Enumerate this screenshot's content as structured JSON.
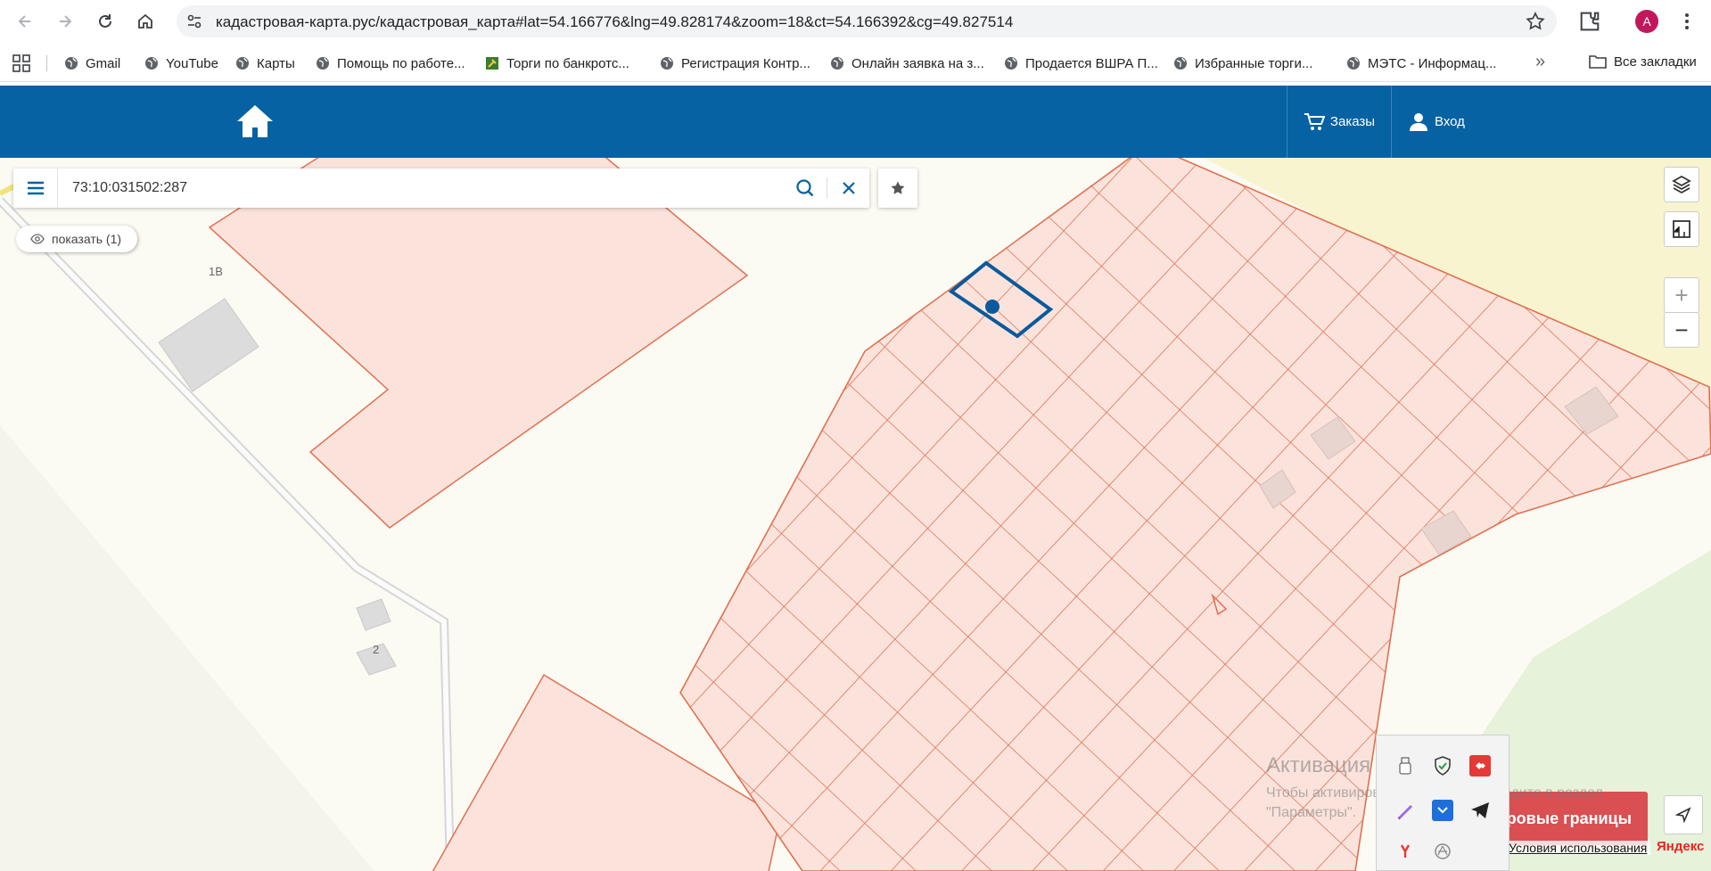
{
  "browser": {
    "url": "кадастровая-карта.рус/кадастровая_карта#lat=54.166776&lng=49.828174&zoom=18&ct=54.166392&cg=49.827514",
    "profile_initial": "A",
    "bookmarks": [
      {
        "label": "Gmail",
        "icon": "gmail-icon"
      },
      {
        "label": "YouTube",
        "icon": "globe-icon"
      },
      {
        "label": "Карты",
        "icon": "globe-icon"
      },
      {
        "label": "Помощь по работе...",
        "icon": "globe-icon"
      },
      {
        "label": "Торги по банкротс...",
        "icon": "gavel-icon"
      },
      {
        "label": "Регистрация Контр...",
        "icon": "globe-icon"
      },
      {
        "label": "Онлайн заявка на з...",
        "icon": "globe-icon"
      },
      {
        "label": "Продается ВШРА П...",
        "icon": "globe-icon"
      },
      {
        "label": "Избранные торги...",
        "icon": "globe-icon"
      },
      {
        "label": "МЭТС - Информац...",
        "icon": "globe-icon"
      }
    ],
    "all_bookmarks_label": "Все закладки"
  },
  "header": {
    "orders_label": "Заказы",
    "login_label": "Вход",
    "color": "#0662a2"
  },
  "search": {
    "value": "73:10:031502:287"
  },
  "map": {
    "show_label": "показать (1)",
    "building_labels": [
      "1В",
      "2"
    ],
    "parcel_stroke": "#e07050",
    "parcel_fill": "#fbe3dc",
    "selected_stroke": "#0a5a9c",
    "zoom_in": "+",
    "zoom_out": "−",
    "borders_button": "тровые границы",
    "terms_link": "Условия использования",
    "yandex_label": "Яндекс"
  },
  "activation": {
    "title": "Активация Windows",
    "subtitle": "Чтобы активировать Windows, перейдите в раздел \"Параметры\"."
  }
}
